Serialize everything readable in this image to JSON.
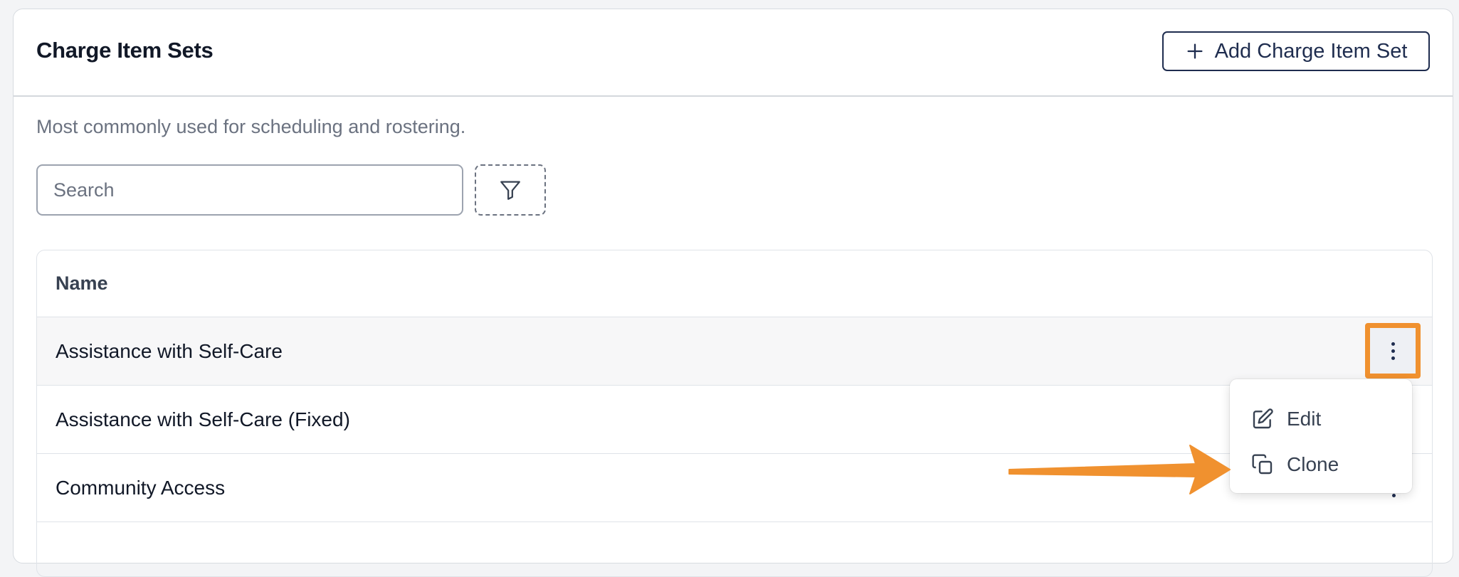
{
  "header": {
    "title": "Charge Item Sets",
    "add_button_label": "Add Charge Item Set"
  },
  "subtitle": "Most commonly used for scheduling and rostering.",
  "search": {
    "placeholder": "Search",
    "value": ""
  },
  "table": {
    "columns": [
      "Name"
    ],
    "rows": [
      {
        "name": "Assistance with Self-Care"
      },
      {
        "name": "Assistance with Self-Care (Fixed)"
      },
      {
        "name": "Community Access"
      }
    ]
  },
  "row_menu": {
    "items": [
      {
        "label": "Edit",
        "icon": "edit-icon"
      },
      {
        "label": "Clone",
        "icon": "clone-icon"
      }
    ]
  },
  "colors": {
    "accent": "#1f2d4f",
    "highlight": "#f0912f",
    "muted_text": "#6b7280"
  }
}
